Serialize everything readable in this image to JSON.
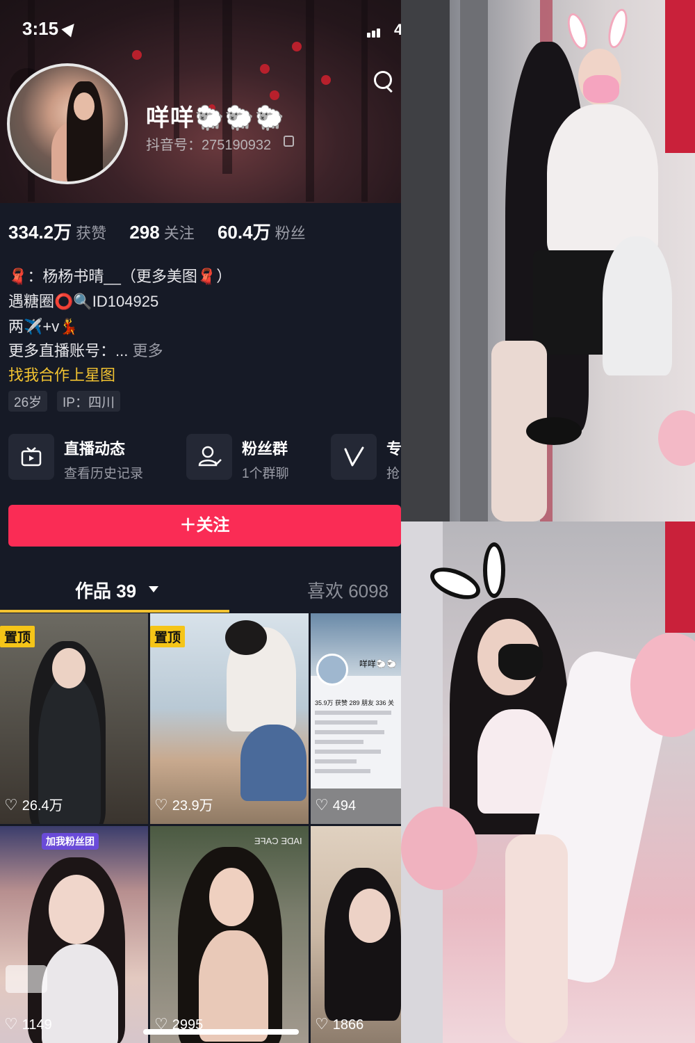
{
  "status_bar": {
    "time": "3:15",
    "battery_fragment": "4"
  },
  "profile": {
    "nickname": "咩咩🐑🐑🐑",
    "douyin_id": "抖音号：275190932"
  },
  "stats": [
    {
      "value": "334.2万",
      "label": "获赞"
    },
    {
      "value": "298",
      "label": "关注"
    },
    {
      "value": "60.4万",
      "label": "粉丝"
    }
  ],
  "bio": {
    "line1": "🧣：杨杨书晴__（更多美图🧣）",
    "line2": "遇糖圈⭕🔍ID104925",
    "line3": "两✈️+v💃",
    "line4": "更多直播账号：...",
    "more": "更多",
    "star_link": "找我合作上星图"
  },
  "tags": [
    "26岁",
    "IP：四川"
  ],
  "cards": [
    {
      "title": "直播动态",
      "subtitle": "查看历史记录",
      "icon": "tv-icon"
    },
    {
      "title": "粉丝群",
      "subtitle": "1个群聊",
      "icon": "group-icon"
    },
    {
      "title": "专",
      "subtitle": "抢",
      "icon": "v-icon"
    }
  ],
  "follow_button": "＋关注",
  "tabs": {
    "works": "作品 39",
    "likes": "喜欢 6098"
  },
  "videos": [
    {
      "likes": "26.4万",
      "pinned": "置顶"
    },
    {
      "likes": "23.9万",
      "pinned": "置顶"
    },
    {
      "likes": "494",
      "pinned": ""
    },
    {
      "likes": "1149",
      "pinned": ""
    },
    {
      "likes": "2995",
      "pinned": ""
    },
    {
      "likes": "1866",
      "pinned": ""
    }
  ],
  "video_overlays": {
    "screenshot_name": "咩咩🐑🐑",
    "screenshot_stats": "35.9万 获赞   289 朋友   336 关",
    "badge_text": "加我粉丝团",
    "sign_text": "IADE CAFE"
  }
}
